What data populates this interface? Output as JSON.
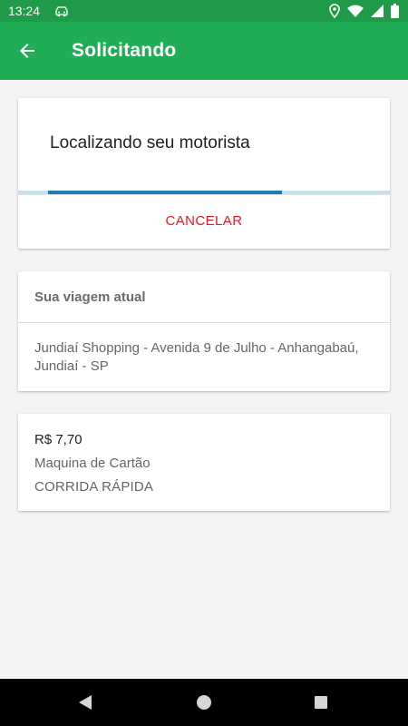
{
  "status_bar": {
    "time": "13:24",
    "icons": [
      "car-icon",
      "location-icon",
      "wifi-icon",
      "signal-icon",
      "battery-icon"
    ]
  },
  "app_bar": {
    "title": "Solicitando",
    "back_icon": "arrow-left-icon",
    "color": "#21ad55"
  },
  "search_card": {
    "message": "Localizando seu motorista",
    "cancel_label": "CANCELAR",
    "cancel_color": "#e8171e"
  },
  "trip_card": {
    "title": "Sua viagem atual",
    "address": "Jundiaí Shopping - Avenida 9 de Julho - Anhangabaú, Jundiaí - SP"
  },
  "fare_card": {
    "price": "R$ 7,70",
    "payment_method": "Maquina de Cartão",
    "ride_type": "CORRIDA RÁPIDA"
  },
  "nav_bar": {
    "icons": [
      "nav-back-icon",
      "nav-home-icon",
      "nav-recents-icon"
    ]
  }
}
